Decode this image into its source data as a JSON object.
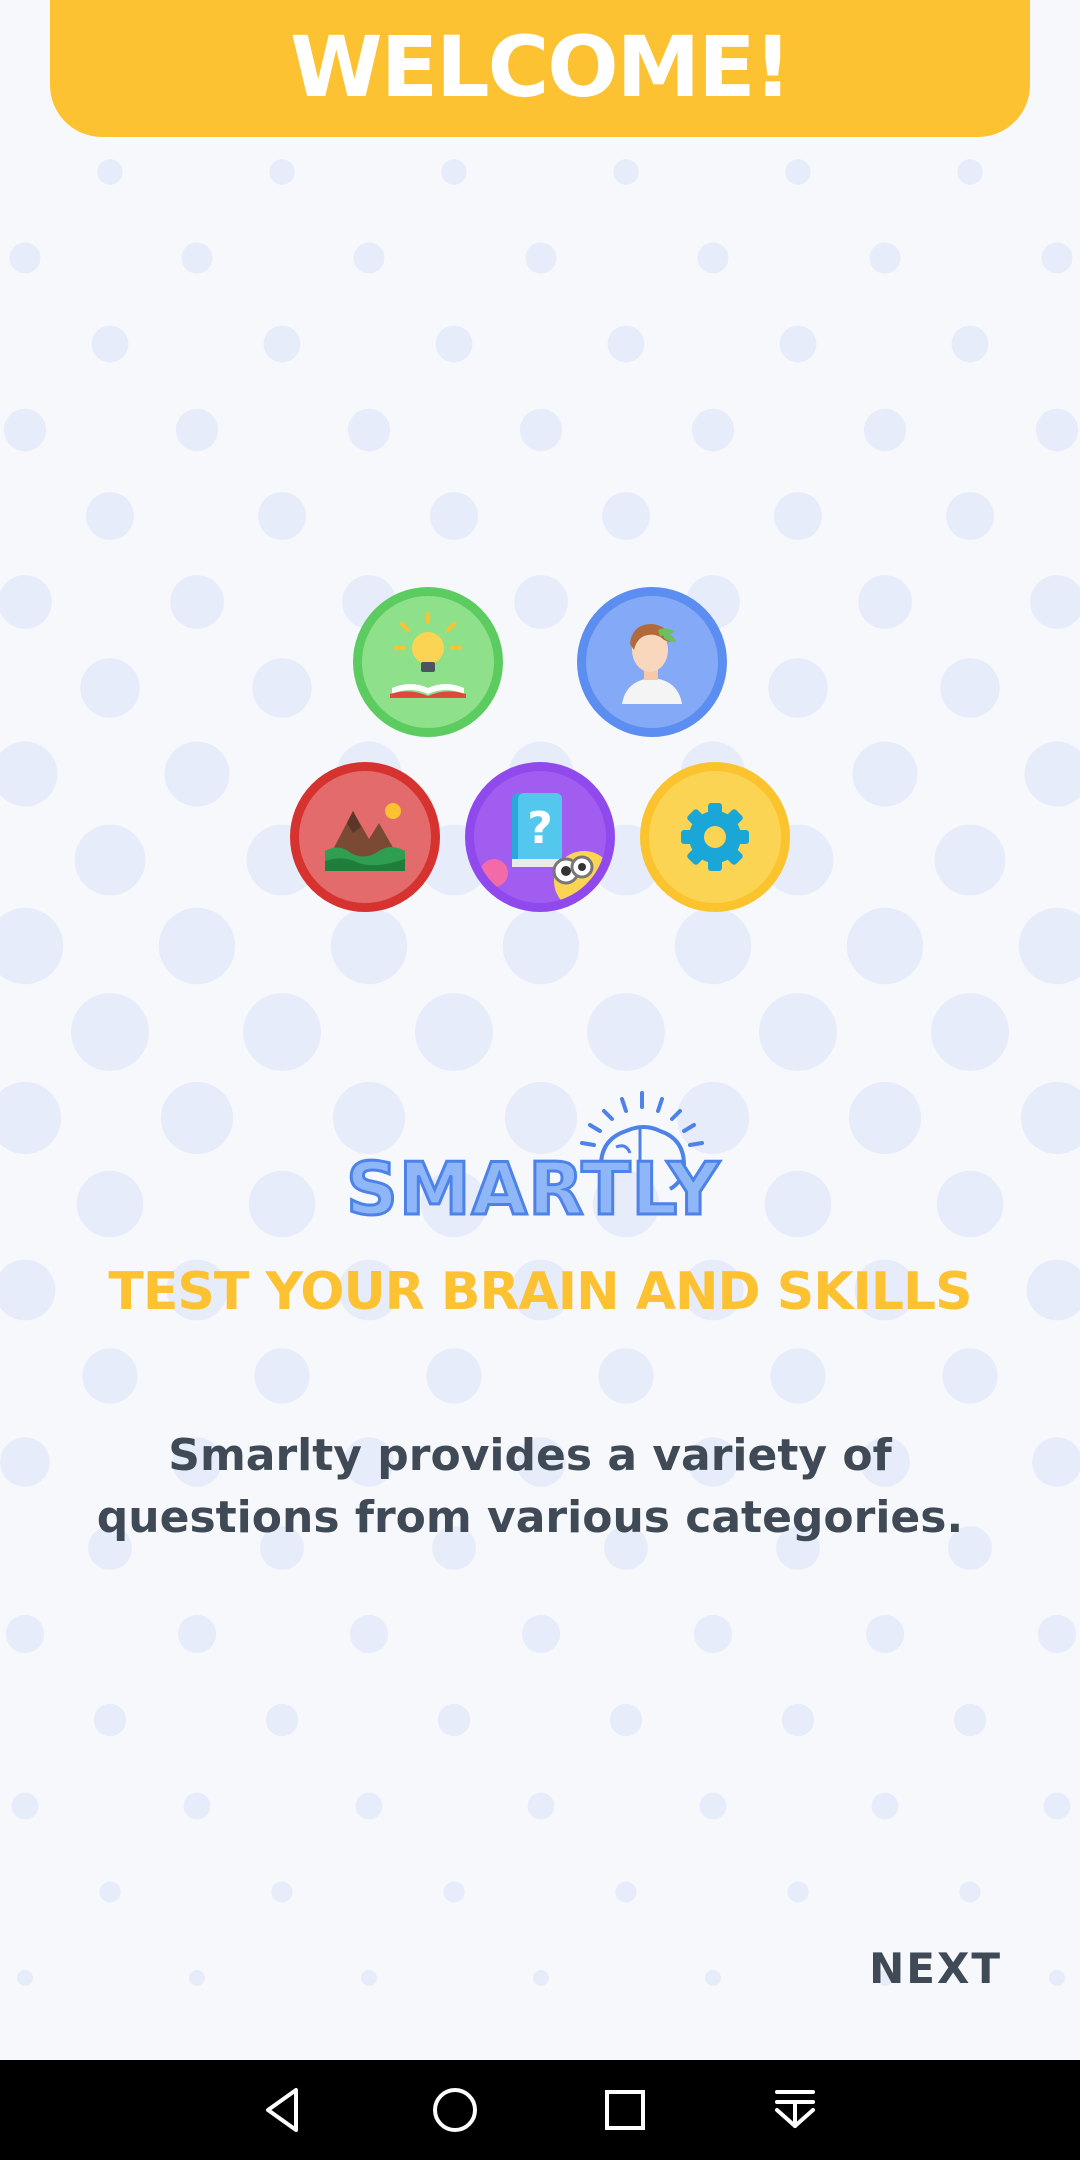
{
  "banner": {
    "title": "WELCOME!",
    "color": "#fcc232"
  },
  "categories": [
    {
      "name": "knowledge",
      "icon": "lightbulb-book-icon",
      "color": "#5ccc60"
    },
    {
      "name": "history",
      "icon": "greek-bust-icon",
      "color": "#5b8ef0"
    },
    {
      "name": "geography",
      "icon": "mountain-landscape-icon",
      "color": "#d6322f"
    },
    {
      "name": "quiz",
      "icon": "question-book-icon",
      "color": "#9049ec"
    },
    {
      "name": "settings",
      "icon": "gear-icon",
      "color": "#fbc42e"
    }
  ],
  "logo": {
    "text": "SMARTLY",
    "icon": "brain-rays-icon"
  },
  "tagline": "TEST YOUR BRAIN AND SKILLS",
  "description": "Smarlty provides a variety of questions from various categories.",
  "next_label": "NEXT",
  "navbar": {
    "back_icon": "back-triangle-icon",
    "home_icon": "home-circle-icon",
    "recents_icon": "recents-square-icon",
    "notifications_icon": "pull-down-icon"
  }
}
